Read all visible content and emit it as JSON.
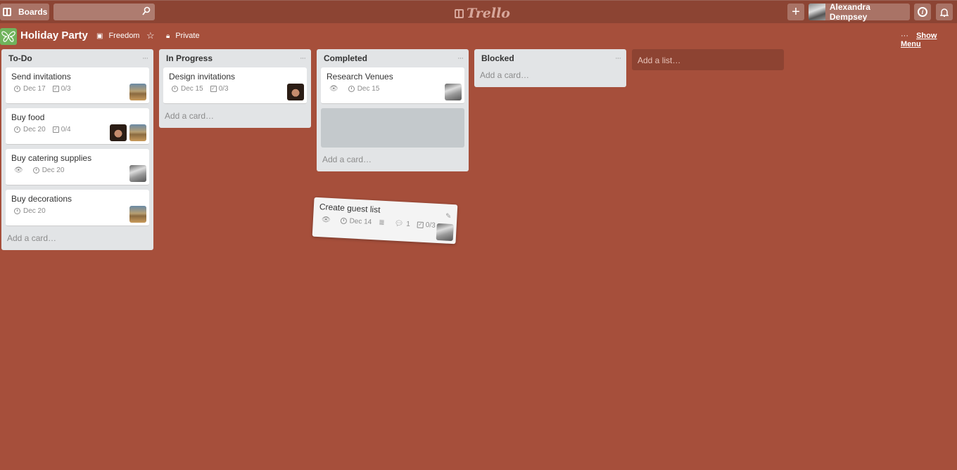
{
  "topbar": {
    "boards_label": "Boards",
    "search_placeholder": "",
    "logo_text": "Trello",
    "add_label": "+",
    "user_name": "Alexandra Dempsey",
    "info_label": "i",
    "bell_label": "🔔"
  },
  "board": {
    "title": "Holiday Party",
    "team": "Freedom",
    "visibility": "Private",
    "menu_dots": "···",
    "show_menu": "Show Menu",
    "logo_color": "#70b35c",
    "background_color": "#a64f3b"
  },
  "lists": [
    {
      "title": "To-Do",
      "cards": [
        {
          "title": "Send invitations",
          "due": "Dec 17",
          "checklist": "0/3"
        },
        {
          "title": "Buy food",
          "due": "Dec 20",
          "checklist": "0/4"
        },
        {
          "title": "Buy catering supplies",
          "due": "Dec 20"
        },
        {
          "title": "Buy decorations",
          "due": "Dec 20"
        }
      ],
      "add_card": "Add a card…"
    },
    {
      "title": "In Progress",
      "cards": [
        {
          "title": "Design invitations",
          "due": "Dec 15",
          "checklist": "0/3"
        }
      ],
      "add_card": "Add a card…"
    },
    {
      "title": "Completed",
      "cards": [
        {
          "title": "Research Venues",
          "due": "Dec 15"
        }
      ],
      "add_card": "Add a card…"
    },
    {
      "title": "Blocked",
      "cards": [],
      "add_card": "Add a card…"
    }
  ],
  "list_menu": "···",
  "add_list": "Add a list…",
  "dragged_card": {
    "title": "Create guest list",
    "due": "Dec 14",
    "comments": "1",
    "checklist": "0/3"
  }
}
